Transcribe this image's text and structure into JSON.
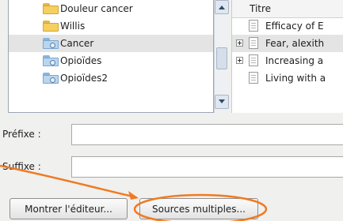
{
  "collections": {
    "items": [
      {
        "label": "Douleur cancer",
        "icon": "folder-icon",
        "selected": false
      },
      {
        "label": "Willis",
        "icon": "folder-icon",
        "selected": false
      },
      {
        "label": "Cancer",
        "icon": "saved-search-icon",
        "selected": true
      },
      {
        "label": "Opioïdes",
        "icon": "saved-search-icon",
        "selected": false
      },
      {
        "label": "Opioïdes2",
        "icon": "saved-search-icon",
        "selected": false
      }
    ]
  },
  "items_list": {
    "header": "Titre",
    "rows": [
      {
        "title": "Efficacy of E",
        "expandable": false
      },
      {
        "title": "Fear, alexith",
        "expandable": true
      },
      {
        "title": "Increasing a",
        "expandable": true
      },
      {
        "title": "Living with a",
        "expandable": false
      }
    ]
  },
  "fields": {
    "prefix_label": "Préfixe :",
    "suffix_label": "Suffixe :",
    "prefix_value": "",
    "suffix_value": ""
  },
  "buttons": {
    "show_editor": "Montrer l'éditeur...",
    "multiple_sources": "Sources multiples..."
  },
  "colors": {
    "annotation": "#f07a23",
    "folder": "#f5cf5f",
    "saved_search": "#b9d6ef"
  }
}
